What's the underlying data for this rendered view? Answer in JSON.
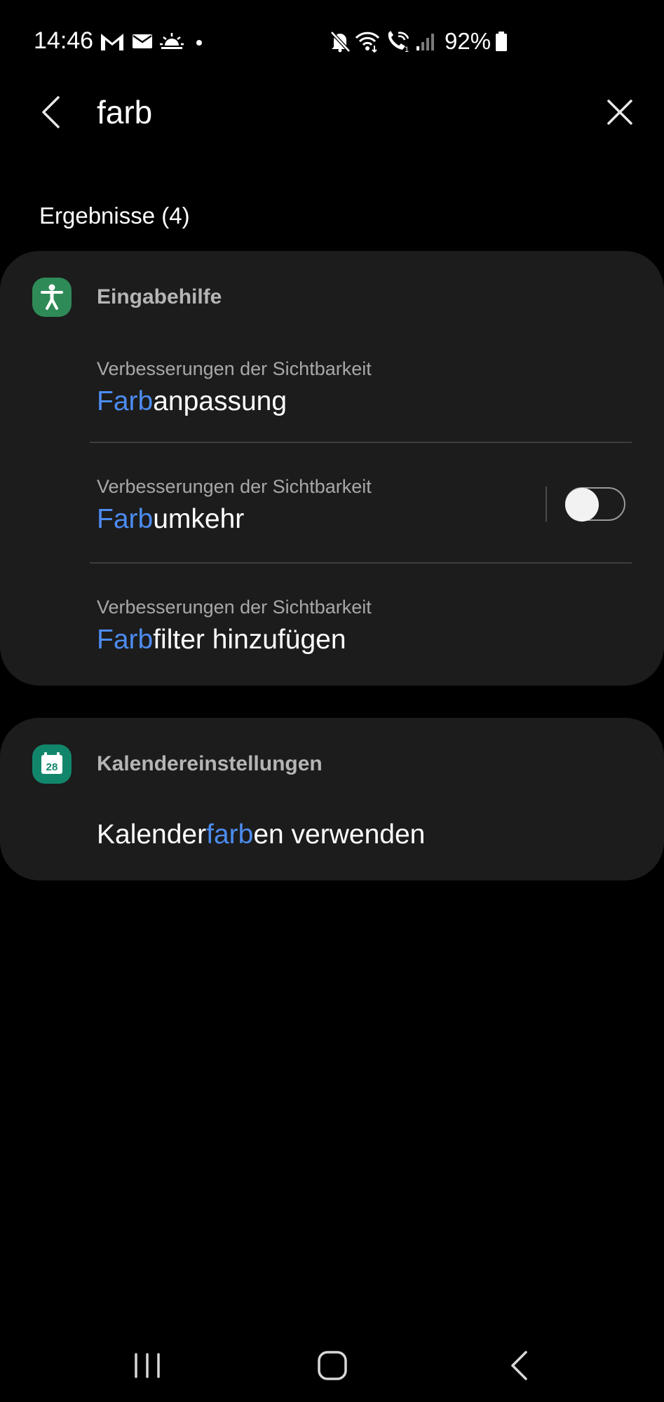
{
  "status_bar": {
    "time": "14:46",
    "notification_icons": [
      "gmail-icon",
      "mail-icon",
      "weather-sunrise-icon",
      "dot-icon"
    ],
    "system_icons": [
      "mute-icon",
      "wifi-icon",
      "wifi-calling-icon",
      "signal-icon",
      "battery-icon"
    ],
    "battery_percent": "92%"
  },
  "search": {
    "query": "farb",
    "back_icon": "chevron-left-icon",
    "clear_icon": "close-icon"
  },
  "results": {
    "heading": "Ergebnisse (4)",
    "groups": [
      {
        "app": "Eingabehilfe",
        "icon": "accessibility-icon",
        "icon_color": "#2e8b57",
        "items": [
          {
            "subtitle": "Verbesserungen der Sichtbarkeit",
            "title_pre": "",
            "title_match": "Farb",
            "title_post": "anpassung"
          },
          {
            "subtitle": "Verbesserungen der Sichtbarkeit",
            "title_pre": "",
            "title_match": "Farb",
            "title_post": "umkehr",
            "toggle": "off"
          },
          {
            "subtitle": "Verbesserungen der Sichtbarkeit",
            "title_pre": "",
            "title_match": "Farb",
            "title_post": "filter hinzufügen"
          }
        ]
      },
      {
        "app": "Kalendereinstellungen",
        "icon": "calendar-icon",
        "icon_color": "#12866b",
        "icon_text": "28",
        "items": [
          {
            "title_pre": "Kalender",
            "title_match": "farb",
            "title_post": "en verwenden"
          }
        ]
      }
    ]
  },
  "colors": {
    "background": "#000000",
    "card": "#1c1c1c",
    "highlight": "#4c8cf0",
    "subtitle": "#a8a8a8"
  },
  "nav_bar": {
    "icons": [
      "recents-icon",
      "home-icon",
      "back-icon"
    ]
  }
}
